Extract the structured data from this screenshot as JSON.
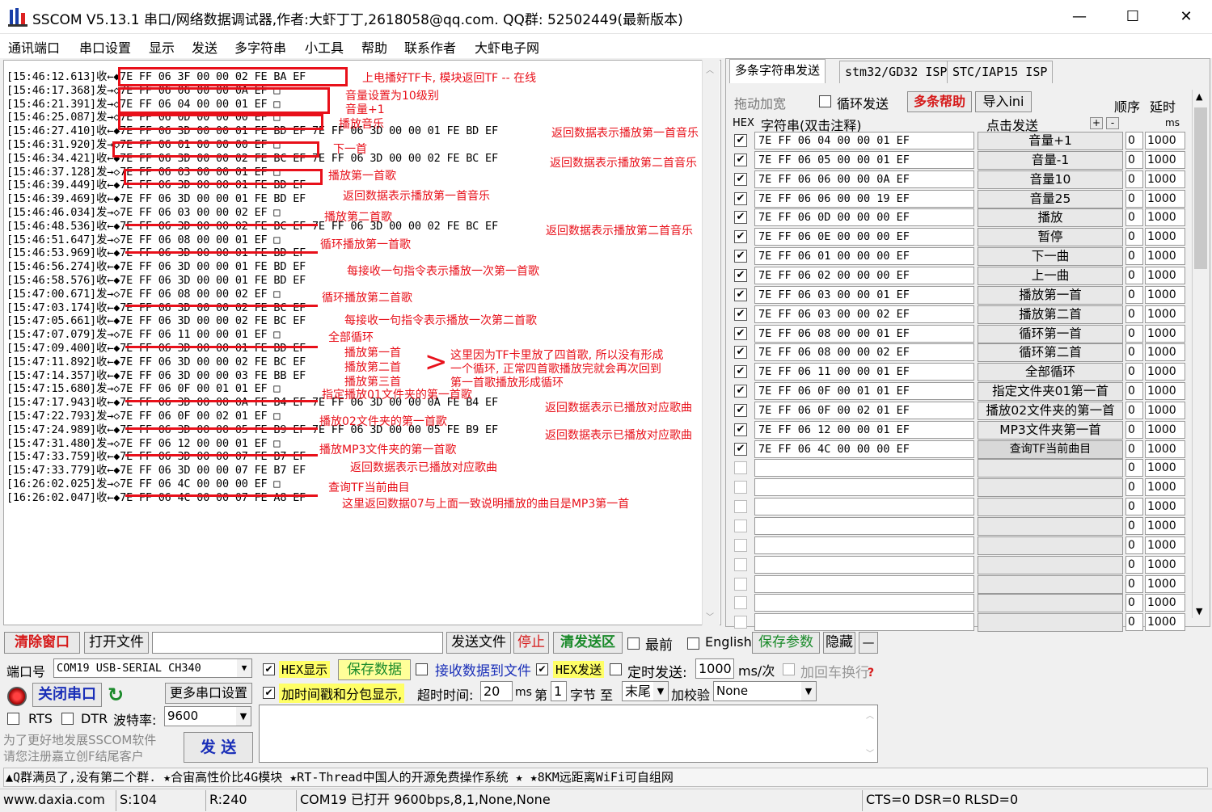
{
  "window": {
    "title": "SSCOM V5.13.1 串口/网络数据调试器,作者:大虾丁丁,2618058@qq.com. QQ群: 52502449(最新版本)",
    "minimize": "—",
    "maximize": "☐",
    "close": "✕"
  },
  "menu": [
    "通讯端口",
    "串口设置",
    "显示",
    "发送",
    "多字符串",
    "小工具",
    "帮助",
    "联系作者",
    "大虾电子网"
  ],
  "log": [
    "[15:46:12.613]收←◆7E FF 06 3F 00 00 02 FE BA EF",
    "[15:46:17.368]发→◇7E FF 06 06 00 00 0A EF □",
    "[15:46:21.391]发→◇7E FF 06 04 00 00 01 EF □",
    "[15:46:25.087]发→◇7E FF 06 0D 00 00 00 EF □",
    "[15:46:27.410]收←◆7E FF 06 3D 00 00 01 FE BD EF 7E FF 06 3D 00 00 01 FE BD EF",
    "[15:46:31.920]发→◇7E FF 06 01 00 00 00 EF □",
    "[15:46:34.421]收←◆7E FF 06 3D 00 00 02 FE BC EF 7E FF 06 3D 00 00 02 FE BC EF",
    "[15:46:37.128]发→◇7E FF 06 03 00 00 01 EF □",
    "[15:46:39.449]收←◆7E FF 06 3D 00 00 01 FE BD EF",
    "[15:46:39.469]收←◆7E FF 06 3D 00 00 01 FE BD EF",
    "[15:46:46.034]发→◇7E FF 06 03 00 00 02 EF □",
    "[15:46:48.536]收←◆7E FF 06 3D 00 00 02 FE BC EF 7E FF 06 3D 00 00 02 FE BC EF",
    "[15:46:51.647]发→◇7E FF 06 08 00 00 01 EF □",
    "[15:46:53.969]收←◆7E FF 06 3D 00 00 01 FE BD EF",
    "[15:46:56.274]收←◆7E FF 06 3D 00 00 01 FE BD EF",
    "[15:46:58.576]收←◆7E FF 06 3D 00 00 01 FE BD EF",
    "[15:47:00.671]发→◇7E FF 06 08 00 00 02 EF □",
    "[15:47:03.174]收←◆7E FF 06 3D 00 00 02 FE BC EF",
    "[15:47:05.661]收←◆7E FF 06 3D 00 00 02 FE BC EF",
    "[15:47:07.079]发→◇7E FF 06 11 00 00 01 EF □",
    "[15:47:09.400]收←◆7E FF 06 3D 00 00 01 FE BD EF",
    "[15:47:11.892]收←◆7E FF 06 3D 00 00 02 FE BC EF",
    "[15:47:14.357]收←◆7E FF 06 3D 00 00 03 FE BB EF",
    "[15:47:15.680]发→◇7E FF 06 0F 00 01 01 EF □",
    "[15:47:17.943]收←◆7E FF 06 3D 00 00 0A FE B4 EF 7E FF 06 3D 00 00 0A FE B4 EF",
    "[15:47:22.793]发→◇7E FF 06 0F 00 02 01 EF □",
    "[15:47:24.989]收←◆7E FF 06 3D 00 00 05 FE B9 EF 7E FF 06 3D 00 00 05 FE B9 EF",
    "[15:47:31.480]发→◇7E FF 06 12 00 00 01 EF □",
    "[15:47:33.759]收←◆7E FF 06 3D 00 00 07 FE B7 EF",
    "[15:47:33.779]收←◆7E FF 06 3D 00 00 07 FE B7 EF",
    "[16:26:02.025]发→◇7E FF 06 4C 00 00 00 EF □",
    "[16:26:02.047]收←◆7E FF 06 4C 00 00 07 FE A8 EF"
  ],
  "annotations": {
    "a1": "上电播好TF卡, 模块返回TF -- 在线",
    "a2": "音量设置为10级别",
    "a3": "音量+1",
    "a4": "播放音乐",
    "a5": "返回数据表示播放第一首音乐",
    "a6": "下一首",
    "a7": "返回数据表示播放第二首音乐",
    "a8": "播放第一首歌",
    "a9": "返回数据表示播放第一首音乐",
    "a10": "播放第二首歌",
    "a11": "返回数据表示播放第二首音乐",
    "a12": "循环播放第一首歌",
    "a13": "每接收一句指令表示播放一次第一首歌",
    "a14": "循环播放第二首歌",
    "a15": "每接收一句指令表示播放一次第二首歌",
    "a16": "全部循环",
    "a17": "播放第一首",
    "a18": "播放第二首",
    "a19": "播放第三首",
    "a20": "这里因为TF卡里放了四首歌, 所以没有形成",
    "a21": "一个循环, 正常四首歌播放完就会再次回到",
    "a22": "第一首歌播放形成循环",
    "a23": "指定播放01文件夹的第一首歌",
    "a24": "返回数据表示已播放对应歌曲",
    "a25": "播放02文件夹的第一首歌",
    "a26": "返回数据表示已播放对应歌曲",
    "a27": "播放MP3文件夹的第一首歌",
    "a28": "返回数据表示已播放对应歌曲",
    "a29": "查询TF当前曲目",
    "a30": "这里返回数据07与上面一致说明播放的曲目是MP3第一首"
  },
  "tabs": [
    "多条字符串发送",
    "stm32/GD32 ISP",
    "STC/IAP15 ISP"
  ],
  "multi": {
    "drag_add": "拖动加宽",
    "loop_send": "循环发送",
    "help": "多条帮助",
    "import": "导入ini",
    "order": "顺序",
    "delay": "延时",
    "hex": "HEX",
    "string_col": "字符串(双击注释)",
    "click_send": "点击发送",
    "plus": "+",
    "minus": "-",
    "ms": "ms",
    "rows": [
      {
        "checked": true,
        "text": "7E FF 06 04 00 00 01 EF",
        "btn": "音量+1",
        "order": "0",
        "delay": "1000"
      },
      {
        "checked": true,
        "text": "7E FF 06 05 00 00 01 EF",
        "btn": "音量-1",
        "order": "0",
        "delay": "1000"
      },
      {
        "checked": true,
        "text": "7E FF 06 06 00 00 0A EF",
        "btn": "音量10",
        "order": "0",
        "delay": "1000"
      },
      {
        "checked": true,
        "text": "7E FF 06 06 00 00 19 EF",
        "btn": "音量25",
        "order": "0",
        "delay": "1000"
      },
      {
        "checked": true,
        "text": "7E FF 06 0D 00 00 00 EF",
        "btn": "播放",
        "order": "0",
        "delay": "1000"
      },
      {
        "checked": true,
        "text": "7E FF 06 0E 00 00 00 EF",
        "btn": "暂停",
        "order": "0",
        "delay": "1000"
      },
      {
        "checked": true,
        "text": "7E FF 06 01 00 00 00 EF",
        "btn": "下一曲",
        "order": "0",
        "delay": "1000"
      },
      {
        "checked": true,
        "text": "7E FF 06 02 00 00 00 EF",
        "btn": "上一曲",
        "order": "0",
        "delay": "1000"
      },
      {
        "checked": true,
        "text": "7E FF 06 03 00 00 01 EF",
        "btn": "播放第一首",
        "order": "0",
        "delay": "1000"
      },
      {
        "checked": true,
        "text": "7E FF 06 03 00 00 02 EF",
        "btn": "播放第二首",
        "order": "0",
        "delay": "1000"
      },
      {
        "checked": true,
        "text": "7E FF 06 08 00 00 01 EF",
        "btn": "循环第一首",
        "order": "0",
        "delay": "1000"
      },
      {
        "checked": true,
        "text": "7E FF 06 08 00 00 02 EF",
        "btn": "循环第二首",
        "order": "0",
        "delay": "1000"
      },
      {
        "checked": true,
        "text": "7E FF 06 11 00 00 01 EF",
        "btn": "全部循环",
        "order": "0",
        "delay": "1000"
      },
      {
        "checked": true,
        "text": "7E FF 06 0F 00 01 01 EF",
        "btn": "指定文件夹01第一首",
        "order": "0",
        "delay": "1000"
      },
      {
        "checked": true,
        "text": "7E FF 06 0F 00 02 01 EF",
        "btn": "播放02文件夹的第一首",
        "order": "0",
        "delay": "1000"
      },
      {
        "checked": true,
        "text": "7E FF 06 12 00 00 01 EF",
        "btn": "MP3文件夹第一首",
        "order": "0",
        "delay": "1000"
      },
      {
        "checked": true,
        "text": "7E FF 06 4C 00 00 00 EF",
        "btn": "查询TF当前曲目",
        "order": "0",
        "delay": "1000"
      },
      {
        "checked": false,
        "text": "",
        "btn": "",
        "order": "0",
        "delay": "1000"
      },
      {
        "checked": false,
        "text": "",
        "btn": "",
        "order": "0",
        "delay": "1000"
      },
      {
        "checked": false,
        "text": "",
        "btn": "",
        "order": "0",
        "delay": "1000"
      },
      {
        "checked": false,
        "text": "",
        "btn": "",
        "order": "0",
        "delay": "1000"
      },
      {
        "checked": false,
        "text": "",
        "btn": "",
        "order": "0",
        "delay": "1000"
      },
      {
        "checked": false,
        "text": "",
        "btn": "",
        "order": "0",
        "delay": "1000"
      },
      {
        "checked": false,
        "text": "",
        "btn": "",
        "order": "0",
        "delay": "1000"
      },
      {
        "checked": false,
        "text": "",
        "btn": "",
        "order": "0",
        "delay": "1000"
      },
      {
        "checked": false,
        "text": "",
        "btn": "",
        "order": "0",
        "delay": "1000"
      }
    ]
  },
  "toolbar": {
    "clear": "清除窗口",
    "open_file": "打开文件",
    "send_file": "发送文件",
    "stop": "停止",
    "clear_send": "清发送区",
    "topmost": "最前",
    "english": "English",
    "save_params": "保存参数",
    "hide": "隐藏",
    "dash": "—"
  },
  "port": {
    "label": "端口号",
    "value": "COM19 USB-SERIAL CH340",
    "close_btn": "关闭串口",
    "more_settings": "更多串口设置",
    "rts": "RTS",
    "dtr": "DTR",
    "baud_label": "波特率:",
    "baud": "9600"
  },
  "options": {
    "hex_display": "HEX显示",
    "save_data": "保存数据",
    "recv_to_file": "接收数据到文件",
    "hex_send": "HEX发送",
    "timed_send": "定时发送:",
    "interval": "1000",
    "interval_unit": "ms/次",
    "crlf": "加回车换行",
    "timestamp": "加时间戳和分包显示,",
    "timeout_label": "超时时间:",
    "timeout": "20",
    "ms": "ms",
    "nth": "第",
    "byte_from": "1",
    "byte_label": "字节 至",
    "tail": "末尾",
    "checksum_label": "加校验",
    "checksum": "None"
  },
  "promo": {
    "line1": "为了更好地发展SSCOM软件",
    "line2": "请您注册嘉立创F结尾客户",
    "send": "发  送"
  },
  "ticker": "▲Q群满员了,没有第二个群. ★合宙高性价比4G模块 ★RT-Thread中国人的开源免费操作系统 ★ ★8KM远距离WiFi可自组网",
  "status": {
    "site": "www.daxia.com",
    "s": "S:104",
    "r": "R:240",
    "port_state": "COM19 已打开  9600bps,8,1,None,None",
    "lines": "CTS=0 DSR=0 RLSD=0"
  },
  "colors": {
    "annotation": "#e8101a",
    "help_red": "#d61a1a",
    "green": "#1a8a2a",
    "blue": "#1a2fb8"
  }
}
